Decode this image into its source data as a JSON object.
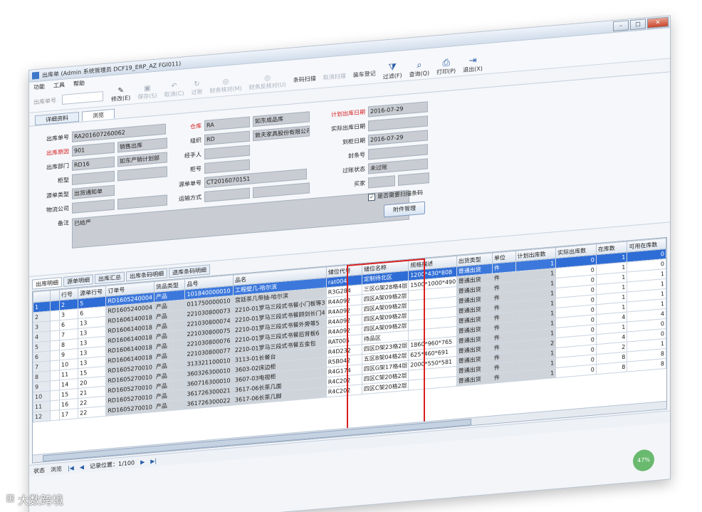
{
  "window": {
    "title": "出库单 (Admin 系统管理员 DCF19_ERP_AZ FGI011)",
    "min": "–",
    "max": "□",
    "close": "✕"
  },
  "menu": [
    "功能",
    "工具",
    "帮助"
  ],
  "toolbar": {
    "input_label": "出库单号",
    "buttons": [
      {
        "label": "修改(E)",
        "icon": "edit-icon",
        "enabled": true
      },
      {
        "label": "保存(S)",
        "icon": "save-icon",
        "enabled": false
      },
      {
        "label": "取消(C)",
        "icon": "undo-icon",
        "enabled": false
      },
      {
        "label": "过账",
        "icon": "post-icon",
        "enabled": false
      },
      {
        "label": "财务核对(M)",
        "icon": "check-icon",
        "enabled": false
      },
      {
        "label": "财务反核对(U)",
        "icon": "uncheck-icon",
        "enabled": false
      },
      {
        "label": "条码扫描",
        "icon": "",
        "enabled": true
      },
      {
        "label": "取消扫描",
        "icon": "",
        "enabled": false
      },
      {
        "label": "装车登记",
        "icon": "",
        "enabled": true
      },
      {
        "label": "过滤(F)",
        "icon": "filter-icon",
        "enabled": true
      },
      {
        "label": "查询(Q)",
        "icon": "query-icon",
        "enabled": true
      },
      {
        "label": "打印(P)",
        "icon": "print-icon",
        "enabled": true
      },
      {
        "label": "退出(X)",
        "icon": "exit-icon",
        "enabled": true
      }
    ]
  },
  "subtabs": [
    "详细资料",
    "浏览"
  ],
  "form": {
    "outbound_no": {
      "label": "出库单号",
      "value": "RA201607260062"
    },
    "outbound_type": {
      "label": "出库原因",
      "value": "901",
      "desc": "销售出库"
    },
    "department": {
      "label": "出库部门",
      "value": "RD16",
      "desc": "如东产销计划部"
    },
    "cabinet_type": {
      "label": "柜型",
      "value": ""
    },
    "source_type": {
      "label": "源单类型",
      "value": "出货通知单"
    },
    "logistics": {
      "label": "物流公司",
      "value": ""
    },
    "remark": {
      "label": "备注",
      "value": "已给严"
    },
    "warehouse": {
      "label": "仓库",
      "value": "RA",
      "desc": "如东成品库"
    },
    "org": {
      "label": "组织",
      "value": "RD",
      "desc": "敦夫家具股份有限公司"
    },
    "handler": {
      "label": "经手人",
      "value": ""
    },
    "cabinet_no": {
      "label": "柜号",
      "value": ""
    },
    "source_no": {
      "label": "源单单号",
      "value": "CT2016070151"
    },
    "transport": {
      "label": "运输方式",
      "value": ""
    },
    "plan_date": {
      "label": "计划出库日期",
      "value": "2016-07-29"
    },
    "actual_date": {
      "label": "实际出库日期",
      "value": ""
    },
    "arrival_date": {
      "label": "到柜日期",
      "value": "2016-07-29"
    },
    "seal_no": {
      "label": "封条号",
      "value": ""
    },
    "post_status": {
      "label": "过账状态",
      "value": "未过账"
    },
    "buyer": {
      "label": "买家",
      "value": ""
    },
    "scan_barcode": {
      "label": "是否需要扫描条码",
      "checked": "✓"
    },
    "attach_btn": "附件管理"
  },
  "grid_tabs": [
    "出库明细",
    "源单明细",
    "出库汇总",
    "出库条码明细",
    "退库条码明细"
  ],
  "grid": {
    "columns": [
      "",
      "",
      "行号",
      "源单行号",
      "订单号",
      "货品类型",
      "品号",
      "品名",
      "储位代号",
      "储位名称",
      "规格描述",
      "出货类型",
      "单位",
      "计划出库数",
      "实际出库数",
      "在库数",
      "可用在库数"
    ],
    "rows": [
      [
        "1",
        "",
        "2",
        "5",
        "RD1605240004",
        "产品",
        "101840000010",
        "工程壁几-哈尔滨",
        "rat004",
        "定制待北区",
        "1200*430*808",
        "普通出货",
        "件",
        "1",
        "0",
        "1",
        "0"
      ],
      [
        "2",
        "",
        "3",
        "6",
        "RD1605240004",
        "产品",
        "011750000010",
        "宫廷茶几带抽-哈尔滨",
        "R3G284",
        "三区G架28格4层",
        "1500*1000*490",
        "普通出货",
        "件",
        "1",
        "0",
        "1",
        "0"
      ],
      [
        "3",
        "",
        "6",
        "13",
        "RD1606140018",
        "产品",
        "221030800073",
        "2210-01罗马三段式书餐小门板等3",
        "R4A092",
        "四区A架09格2层",
        "",
        "普通出货",
        "件",
        "1",
        "0",
        "1",
        "1"
      ],
      [
        "4",
        "",
        "7",
        "13",
        "RD1606140018",
        "产品",
        "221030800074",
        "2210-01罗马三段式书餐顾剑长门4",
        "R4A092",
        "四区A架09格2层",
        "",
        "普通出货",
        "件",
        "1",
        "0",
        "1",
        "1"
      ],
      [
        "5",
        "",
        "8",
        "13",
        "RD1606140018",
        "产品",
        "221030800075",
        "2210-01罗马三段式书餐外旁等5",
        "R4A092",
        "四区A架09格2层",
        "",
        "普通出货",
        "件",
        "1",
        "0",
        "1",
        "1"
      ],
      [
        "6",
        "",
        "9",
        "13",
        "RD1606140018",
        "产品",
        "221030800076",
        "2210-01罗马三段式书餐后背板6",
        "R4A092",
        "四区A架09格2层",
        "",
        "普通出货",
        "件",
        "1",
        "0",
        "1",
        "1"
      ],
      [
        "7",
        "",
        "10",
        "13",
        "RD1606140018",
        "产品",
        "221030800077",
        "2210-01罗马三段式书餐五金包",
        "RAT005",
        "待品区",
        "",
        "普通出货",
        "件",
        "1",
        "0",
        "4",
        "4"
      ],
      [
        "8",
        "",
        "11",
        "15",
        "RD1605270010",
        "产品",
        "313321100010",
        "3113-01长餐台",
        "R4D232",
        "四区D架23格2层",
        "1860*960*765",
        "普通出货",
        "件",
        "1",
        "0",
        "1",
        "0"
      ],
      [
        "9",
        "",
        "14",
        "20",
        "RD1605270010",
        "产品",
        "360326300010",
        "3603-02床边柜",
        "R5B042",
        "五区B架04格2层",
        "625*460*691",
        "普通出货",
        "件",
        "2",
        "0",
        "4",
        "0"
      ],
      [
        "10",
        "",
        "15",
        "21",
        "RD1605270010",
        "产品",
        "360716300010",
        "3607-03电视柜",
        "R4G174",
        "四区G架17格4层",
        "2000*550*581",
        "普通出货",
        "件",
        "1",
        "0",
        "2",
        "1"
      ],
      [
        "11",
        "",
        "16",
        "22",
        "RD1605270010",
        "产品",
        "361726300021",
        "3617-06长茶几面",
        "R4C202",
        "四区C架20格2层",
        "",
        "普通出货",
        "件",
        "1",
        "0",
        "8",
        "8"
      ],
      [
        "12",
        "",
        "17",
        "22",
        "RD1605270010",
        "产品",
        "361726300022",
        "3617-06长茶几脚",
        "R4C202",
        "四区C架20格2层",
        "",
        "普通出货",
        "件",
        "1",
        "0",
        "8",
        "8"
      ]
    ]
  },
  "statusbar": {
    "status_label": "状态",
    "status_value": "浏览",
    "record_label": "记录位置：1/100"
  },
  "progress_badge": "47%",
  "watermark": {
    "text": "大数跨境",
    "logo": "ꕥ"
  }
}
